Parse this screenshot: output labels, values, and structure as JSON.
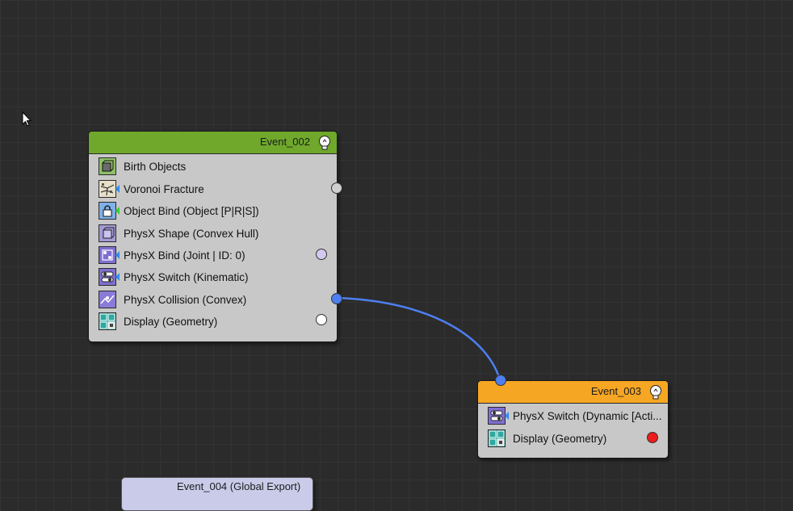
{
  "colors": {
    "canvas_bg": "#2b2b2b",
    "node_body": "#c8c8c8",
    "event_002_header": "#6fa82b",
    "event_003_header": "#f5a623",
    "event_004_header": "#c9cbe9",
    "wire": "#4d7ff0"
  },
  "event_002": {
    "title": "Event_002",
    "operators": [
      {
        "label": "Birth Objects",
        "icon": "birth-objects-icon"
      },
      {
        "label": "Voronoi Fracture",
        "icon": "voronoi-fracture-icon"
      },
      {
        "label": "Object Bind (Object [P|R|S])",
        "icon": "object-bind-icon"
      },
      {
        "label": "PhysX Shape (Convex Hull)",
        "icon": "physx-shape-icon"
      },
      {
        "label": "PhysX Bind (Joint | ID: 0)",
        "icon": "physx-bind-icon"
      },
      {
        "label": "PhysX Switch (Kinematic)",
        "icon": "physx-switch-icon"
      },
      {
        "label": "PhysX Collision (Convex)",
        "icon": "physx-collision-icon"
      },
      {
        "label": "Display (Geometry)",
        "icon": "display-geometry-icon"
      }
    ]
  },
  "event_003": {
    "title": "Event_003",
    "operators": [
      {
        "label": "PhysX Switch (Dynamic [Acti...",
        "icon": "physx-switch-icon"
      },
      {
        "label": "Display (Geometry)",
        "icon": "display-geometry-icon"
      }
    ]
  },
  "event_004": {
    "title": "Event_004 (Global Export)"
  }
}
